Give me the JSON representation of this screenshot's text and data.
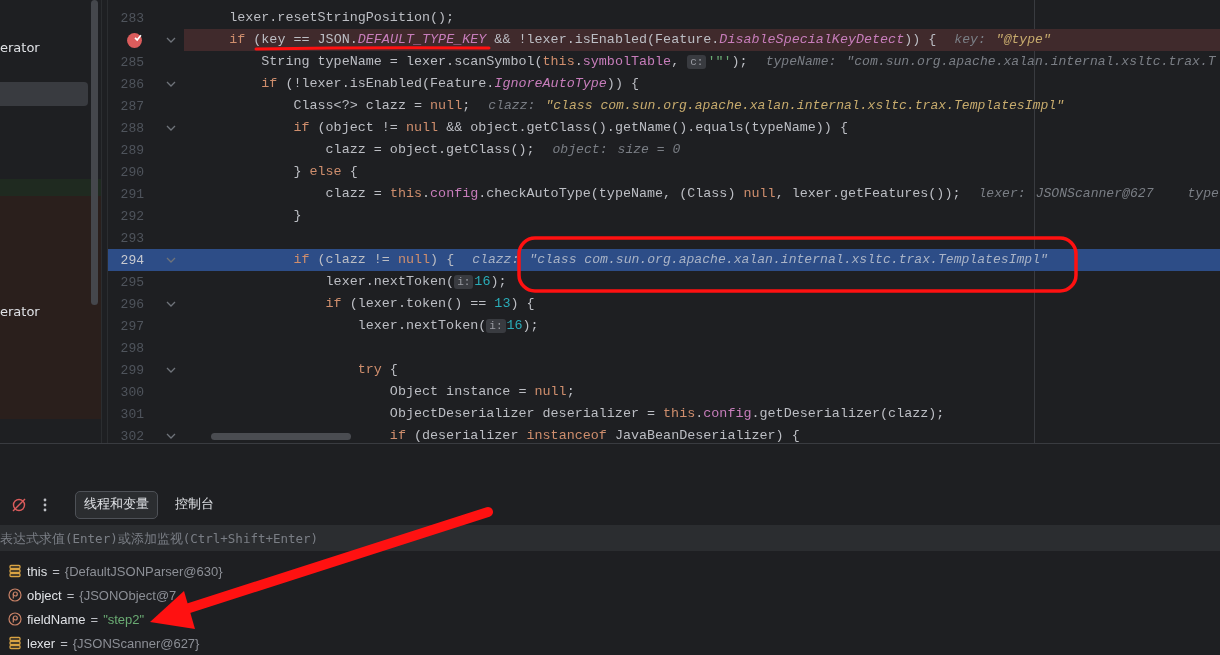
{
  "sidebar": {
    "items": [
      {
        "kind": "row",
        "label": "erator",
        "selected": false
      },
      {
        "kind": "row",
        "selected": true
      },
      {
        "kind": "marker"
      },
      {
        "kind": "block",
        "label": "erator"
      }
    ]
  },
  "editor": {
    "lines": [
      {
        "no": "283",
        "fold": false,
        "breakpoint": false,
        "current": false,
        "tokens": [
          {
            "kind": "p",
            "text": "    lexer.resetStringPosition();"
          }
        ]
      },
      {
        "fold": true,
        "breakpoint": true,
        "current": false,
        "tokens": [
          {
            "kind": "kw",
            "text": "    if"
          },
          {
            "kind": "p",
            "text": " (key == JSON."
          },
          {
            "kind": "const",
            "text": "DEFAULT_TYPE_KEY"
          },
          {
            "kind": "p",
            "text": " && !lexer.isEnabled(Feature."
          },
          {
            "kind": "const",
            "text": "DisableSpecialKeyDetect"
          },
          {
            "kind": "p",
            "text": ")) {"
          }
        ],
        "hints": [
          {
            "label": "key:",
            "value": "\"@type\"",
            "kind": "string"
          }
        ]
      },
      {
        "no": "285",
        "fold": false,
        "breakpoint": false,
        "current": false,
        "tokens": [
          {
            "kind": "p",
            "text": "        String typeName = lexer.scanSymbol("
          },
          {
            "kind": "kw",
            "text": "this"
          },
          {
            "kind": "p",
            "text": "."
          },
          {
            "kind": "field",
            "text": "symbolTable"
          },
          {
            "kind": "p",
            "text": ", "
          },
          {
            "kind": "chip",
            "text": "c:"
          },
          {
            "kind": "str",
            "text": "'\"'"
          },
          {
            "kind": "p",
            "text": ");"
          }
        ],
        "hints": [
          {
            "label": "typeName:",
            "value": "\"com.sun.org.apache.xalan.internal.xsltc.trax.T",
            "kind": "plain"
          }
        ]
      },
      {
        "no": "286",
        "fold": true,
        "breakpoint": false,
        "current": false,
        "tokens": [
          {
            "kind": "kw",
            "text": "        if"
          },
          {
            "kind": "p",
            "text": " (!lexer.isEnabled(Feature."
          },
          {
            "kind": "const",
            "text": "IgnoreAutoType"
          },
          {
            "kind": "p",
            "text": ")) {"
          }
        ]
      },
      {
        "no": "287",
        "fold": false,
        "breakpoint": false,
        "current": false,
        "tokens": [
          {
            "kind": "p",
            "text": "            Class<?> clazz = "
          },
          {
            "kind": "kw",
            "text": "null"
          },
          {
            "kind": "p",
            "text": ";"
          }
        ],
        "hints": [
          {
            "label": "clazz:",
            "value": "\"class com.sun.org.apache.xalan.internal.xsltc.trax.TemplatesImpl\"",
            "kind": "string"
          }
        ]
      },
      {
        "no": "288",
        "fold": true,
        "breakpoint": false,
        "current": false,
        "tokens": [
          {
            "kind": "kw",
            "text": "            if"
          },
          {
            "kind": "p",
            "text": " (object != "
          },
          {
            "kind": "kw",
            "text": "null"
          },
          {
            "kind": "p",
            "text": " && object.getClass().getName().equals(typeName)) {"
          }
        ]
      },
      {
        "no": "289",
        "fold": false,
        "breakpoint": false,
        "current": false,
        "tokens": [
          {
            "kind": "p",
            "text": "                clazz = object.getClass();"
          }
        ],
        "hints": [
          {
            "label": "object:",
            "value": "size = 0",
            "kind": "plain"
          }
        ]
      },
      {
        "no": "290",
        "fold": false,
        "breakpoint": false,
        "current": false,
        "tokens": [
          {
            "kind": "p",
            "text": "            } "
          },
          {
            "kind": "kw",
            "text": "else"
          },
          {
            "kind": "p",
            "text": " {"
          }
        ]
      },
      {
        "no": "291",
        "fold": false,
        "breakpoint": false,
        "current": false,
        "tokens": [
          {
            "kind": "p",
            "text": "                clazz = "
          },
          {
            "kind": "kw",
            "text": "this"
          },
          {
            "kind": "p",
            "text": "."
          },
          {
            "kind": "field",
            "text": "config"
          },
          {
            "kind": "p",
            "text": ".checkAutoType(typeName, (Class) "
          },
          {
            "kind": "kw",
            "text": "null"
          },
          {
            "kind": "p",
            "text": ", lexer.getFeatures());"
          }
        ],
        "hints": [
          {
            "label": "lexer:",
            "value": "JSONScanner@627",
            "kind": "plain"
          },
          {
            "label": "type"
          }
        ]
      },
      {
        "no": "292",
        "fold": false,
        "breakpoint": false,
        "current": false,
        "tokens": [
          {
            "kind": "p",
            "text": "            }"
          }
        ]
      },
      {
        "no": "293",
        "fold": false,
        "breakpoint": false,
        "current": false
      },
      {
        "no": "294",
        "fold": true,
        "breakpoint": false,
        "current": true,
        "tokens": [
          {
            "kind": "kw",
            "text": "            if"
          },
          {
            "kind": "p",
            "text": " (clazz != "
          },
          {
            "kind": "kw",
            "text": "null"
          },
          {
            "kind": "p",
            "text": ") {"
          }
        ],
        "hints": [
          {
            "label": "clazz:",
            "value": "\"class com.sun.org.apache.xalan.internal.xsltc.trax.TemplatesImpl\"",
            "kind": "string"
          }
        ]
      },
      {
        "no": "295",
        "fold": false,
        "breakpoint": false,
        "current": false,
        "tokens": [
          {
            "kind": "p",
            "text": "                lexer.nextToken("
          },
          {
            "kind": "chip",
            "text": "i:"
          },
          {
            "kind": "num",
            "text": "16"
          },
          {
            "kind": "p",
            "text": ");"
          }
        ]
      },
      {
        "no": "296",
        "fold": true,
        "breakpoint": false,
        "current": false,
        "tokens": [
          {
            "kind": "kw",
            "text": "                if"
          },
          {
            "kind": "p",
            "text": " (lexer.token() == "
          },
          {
            "kind": "num",
            "text": "13"
          },
          {
            "kind": "p",
            "text": ") {"
          }
        ]
      },
      {
        "no": "297",
        "fold": false,
        "breakpoint": false,
        "current": false,
        "tokens": [
          {
            "kind": "p",
            "text": "                    lexer.nextToken("
          },
          {
            "kind": "chip",
            "text": "i:"
          },
          {
            "kind": "num",
            "text": "16"
          },
          {
            "kind": "p",
            "text": ");"
          }
        ]
      },
      {
        "no": "298",
        "fold": false,
        "breakpoint": false,
        "current": false
      },
      {
        "no": "299",
        "fold": true,
        "breakpoint": false,
        "current": false,
        "tokens": [
          {
            "kind": "kw",
            "text": "                    try"
          },
          {
            "kind": "p",
            "text": " {"
          }
        ]
      },
      {
        "no": "300",
        "fold": false,
        "breakpoint": false,
        "current": false,
        "tokens": [
          {
            "kind": "p",
            "text": "                        Object instance = "
          },
          {
            "kind": "kw",
            "text": "null"
          },
          {
            "kind": "p",
            "text": ";"
          }
        ]
      },
      {
        "no": "301",
        "fold": false,
        "breakpoint": false,
        "current": false,
        "tokens": [
          {
            "kind": "p",
            "text": "                        ObjectDeserializer deserializer = "
          },
          {
            "kind": "kw",
            "text": "this"
          },
          {
            "kind": "p",
            "text": "."
          },
          {
            "kind": "field",
            "text": "config"
          },
          {
            "kind": "p",
            "text": ".getDeserializer(clazz);"
          }
        ]
      },
      {
        "no": "302",
        "fold": true,
        "breakpoint": false,
        "current": false,
        "tokens": [
          {
            "kind": "kw",
            "text": "                        if"
          },
          {
            "kind": "p",
            "text": " (deserializer "
          },
          {
            "kind": "kw",
            "text": "instanceof"
          },
          {
            "kind": "p",
            "text": " JavaBeanDeserializer) {"
          }
        ]
      }
    ]
  },
  "debug_panel": {
    "toolbar": [
      {
        "kind": "mute-breakpoints"
      },
      {
        "kind": "more"
      }
    ],
    "tabs": [
      {
        "label": "线程和变量",
        "selected": true
      },
      {
        "label": "控制台",
        "selected": false
      }
    ],
    "expression": {
      "placeholder": "表达式求值(Enter)或添加监视(Ctrl+Shift+Enter)"
    },
    "variables": [
      {
        "kind": "field",
        "name": "this",
        "operator": "=",
        "value": {
          "text": "{DefaultJSONParser@630}",
          "kind": "object"
        }
      },
      {
        "kind": "parameter",
        "name": "object",
        "operator": "=",
        "value": {
          "text": "{JSONObject@7",
          "kind": "object"
        }
      },
      {
        "kind": "parameter",
        "name": "fieldName",
        "operator": "=",
        "value": {
          "text": "\"step2\"",
          "kind": "string"
        }
      },
      {
        "kind": "field",
        "name": "lexer",
        "operator": "=",
        "value": {
          "text": "{JSONScanner@627}",
          "kind": "object"
        }
      }
    ]
  },
  "annotations": [
    {
      "kind": "underline"
    },
    {
      "kind": "circle"
    },
    {
      "kind": "arrow"
    }
  ]
}
